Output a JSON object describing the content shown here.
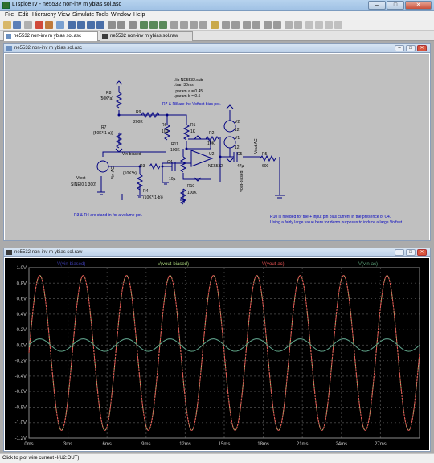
{
  "window": {
    "title": "LTspice IV - ne5532 non-inv m ybias sol.asc",
    "controls": {
      "minimize": "–",
      "maximize": "□",
      "close": "✕"
    }
  },
  "menu": [
    "File",
    "Edit",
    "Hierarchy",
    "View",
    "Simulate",
    "Tools",
    "Window",
    "Help"
  ],
  "tabs": [
    {
      "label": "ne5532 non-inv m ybias sol.asc",
      "active": true
    },
    {
      "label": "ne5532 non-inv m ybias sol.raw",
      "active": false
    }
  ],
  "schematic": {
    "title": "ne5532 non-inv m ybias sol.asc",
    "directives": [
      ".lib NE5532.sub",
      ".tran 30ms",
      ".param a = 0.45",
      ".param b = 0.5"
    ],
    "comments": {
      "voffset": "R7 & R8 are the Voffset bias pot.",
      "volume": "R3 & R4 are stand-in for a volume pot.",
      "r10_line1": "R10 is needed for the + input pin bias current in the presence of C4.",
      "r10_line2": "Using a fairly large value here for demo purposes to induce a large Voffset."
    },
    "components": {
      "r8_name": "R8",
      "r8_val": "{50K*a}",
      "r7_name": "R7",
      "r7_val": "{50K*(1-a)}",
      "r9_name": "R9",
      "r9_val": "200K",
      "r6_name": "R6",
      "r6_val": "100",
      "r1_name": "R1",
      "r1_val": "1K",
      "r11_name": "R11",
      "r11_val": "100K",
      "r2_name": "R2",
      "r2_val": "10K",
      "u2_name": "U2",
      "u2_model": "NE5532",
      "c5_name": "C5",
      "c5_val": "47µ",
      "r5_name": "R5",
      "r5_val": "600",
      "c4_name": "C4",
      "c4_val": "10µ",
      "r3_name": "R3",
      "r3_val": "{10K*b}",
      "r4_name": "R4",
      "r4_val": "{10K*(1-b)}",
      "r10_name": "R10",
      "r10_val": "100K",
      "vtest_name": "Vtest",
      "vtest_val": "SINE(0 1 300)",
      "v2_name": "V2",
      "v2_val": "12",
      "v1_name": "V1",
      "v1_val": "12"
    },
    "net_labels": {
      "vin_biased": "Vin-biased",
      "vin_ac": "Vin-AC",
      "vout_biased": "Vout-biased",
      "vout_ac": "Vout-AC"
    }
  },
  "waveform": {
    "title": "ne5532 non-inv m ybias sol.raw",
    "colors": {
      "background": "#000000",
      "grid": "#3c3c3c",
      "axis_text": "#c8c8c8",
      "vin_biased": "#3a3aa8",
      "vout_biased": "#a8d37a",
      "vout_ac": "#e05050",
      "vin_ac": "#5ca37a"
    }
  },
  "chart_data": {
    "type": "line",
    "xlabel": "",
    "ylabel": "",
    "x_unit": "ms",
    "xlim": [
      0,
      30
    ],
    "ylim": [
      -1.2,
      1.0
    ],
    "xticks": [
      "0ms",
      "3ms",
      "6ms",
      "9ms",
      "12ms",
      "15ms",
      "18ms",
      "21ms",
      "24ms",
      "27ms"
    ],
    "yticks": [
      "1.0V",
      "0.8V",
      "0.6V",
      "0.4V",
      "0.2V",
      "0.0V",
      "-0.2V",
      "-0.4V",
      "-0.6V",
      "-0.8V",
      "-1.0V",
      "-1.2V"
    ],
    "grid": true,
    "legend_placement": "top",
    "series": [
      {
        "name": "V(vin-biased)",
        "kind": "sine",
        "frequency_hz": 300,
        "amplitude_v": 0.08,
        "offset_v": 0.0
      },
      {
        "name": "V(vout-biased)",
        "kind": "sine",
        "frequency_hz": 300,
        "amplitude_v": 1.0,
        "offset_v": -0.1
      },
      {
        "name": "V(vout-ac)",
        "kind": "sine",
        "frequency_hz": 300,
        "amplitude_v": 1.0,
        "offset_v": -0.1
      },
      {
        "name": "V(vin-ac)",
        "kind": "sine",
        "frequency_hz": 300,
        "amplitude_v": 0.08,
        "offset_v": 0.0
      }
    ]
  },
  "statusbar": {
    "text": "Click to plot wire current -I(U2:OUT)"
  }
}
